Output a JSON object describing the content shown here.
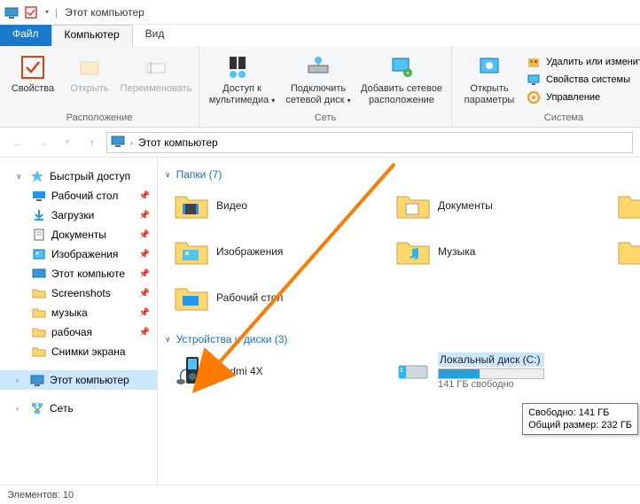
{
  "titlebar": {
    "title": "Этот компьютер"
  },
  "tabs": {
    "file": "Файл",
    "computer": "Компьютер",
    "view": "Вид"
  },
  "ribbon": {
    "group_location": {
      "label": "Расположение",
      "props": "Свойства",
      "open": "Открыть",
      "rename": "Переименовать"
    },
    "group_network": {
      "label": "Сеть",
      "media": "Доступ к\nмультимедиа",
      "map": "Подключить\nсетевой диск",
      "add": "Добавить сетевое\nрасположение"
    },
    "group_system": {
      "label": "Система",
      "settings": "Открыть\nпараметры",
      "uninstall": "Удалить или изменить про",
      "sysprops": "Свойства системы",
      "manage": "Управление"
    }
  },
  "address": {
    "path": "Этот компьютер"
  },
  "nav": {
    "quick": "Быстрый доступ",
    "desktop": "Рабочий стол",
    "downloads": "Загрузки",
    "documents": "Документы",
    "pictures": "Изображения",
    "thispc2": "Этот компьюте",
    "screenshots": "Screenshots",
    "music": "музыка",
    "work": "рабочая",
    "snips": "Снимки экрана",
    "thispc": "Этот компьютер",
    "network": "Сеть"
  },
  "sections": {
    "folders": "Папки (7)",
    "devices": "Устройства и диски (3)"
  },
  "folders": {
    "videos": "Видео",
    "documents": "Документы",
    "pictures": "Изображения",
    "music": "Музыка",
    "desktop": "Рабочий стол"
  },
  "devices": {
    "redmi": "Redmi 4X",
    "localdisk": {
      "name": "Локальный диск (C:)",
      "sub": "141 ГБ свободно"
    }
  },
  "tooltip": {
    "free": "Свободно: 141 ГБ",
    "total": "Общий размер: 232 ГБ"
  },
  "statusbar": {
    "count": "Элементов: 10"
  }
}
